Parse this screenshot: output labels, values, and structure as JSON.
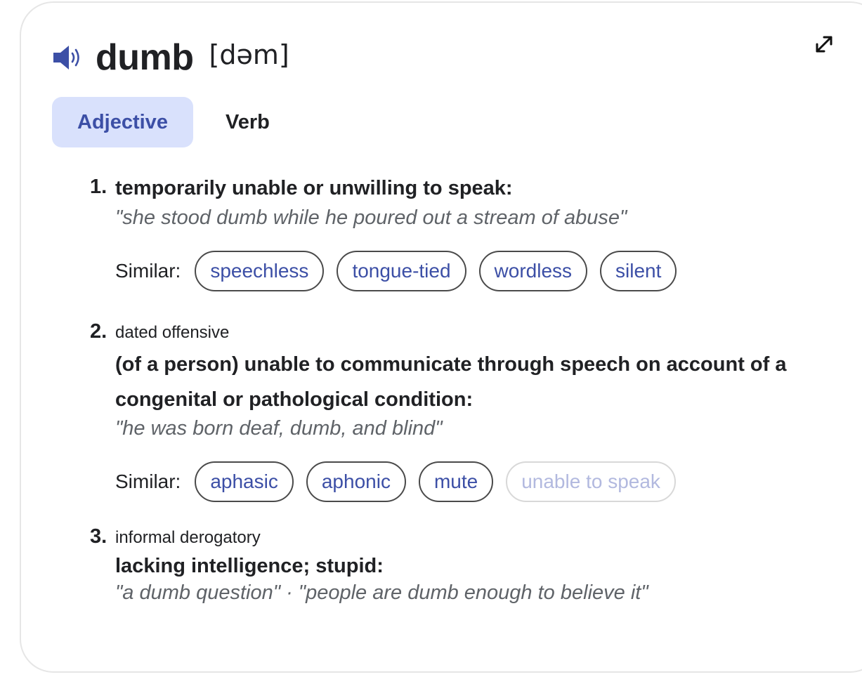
{
  "entry": {
    "word": "dumb",
    "phonetic": "[dəm]"
  },
  "icons": {
    "speaker": "speaker-icon",
    "expand": "expand-icon"
  },
  "colors": {
    "accent": "#3c4fa6",
    "tab_active_bg": "#d9e1fc",
    "example_text": "#5f6368"
  },
  "tabs": [
    {
      "label": "Adjective",
      "active": true
    },
    {
      "label": "Verb",
      "active": false
    }
  ],
  "similar_label": "Similar:",
  "senses": [
    {
      "number": "1.",
      "labels": "",
      "definition": "temporarily unable or unwilling to speak:",
      "example": "\"she stood dumb while he poured out a stream of abuse\"",
      "similar": [
        "speechless",
        "tongue-tied",
        "wordless",
        "silent"
      ]
    },
    {
      "number": "2.",
      "labels": "dated offensive",
      "definition": "(of a person) unable to communicate through speech on account of a congenital or pathological condition:",
      "example": "\"he was born deaf, dumb, and blind\"",
      "similar": [
        "aphasic",
        "aphonic",
        "mute",
        "unable to speak"
      ]
    },
    {
      "number": "3.",
      "labels": "informal derogatory",
      "definition": "lacking intelligence; stupid:",
      "example": "\"a dumb question\" · \"people are dumb enough to believe it\""
    }
  ]
}
